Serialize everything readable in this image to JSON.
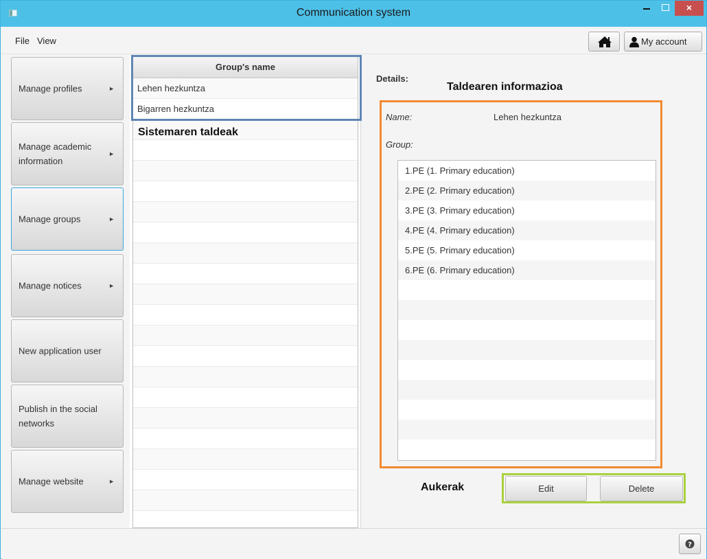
{
  "window": {
    "title": "Communication system",
    "close_label": "×"
  },
  "menubar": {
    "file": "File",
    "view": "View"
  },
  "toolbar": {
    "home_icon": "home-icon",
    "account_icon": "user-icon",
    "account_label": "My account"
  },
  "sidebar": {
    "items": [
      {
        "label": "Manage profiles",
        "arrow": "►"
      },
      {
        "label": "Manage academic information",
        "arrow": "►"
      },
      {
        "label": "Manage groups",
        "arrow": "►",
        "active": true
      },
      {
        "label": "Manage notices",
        "arrow": "►"
      },
      {
        "label": "New application user",
        "arrow": ""
      },
      {
        "label": "Publish in the social networks",
        "arrow": ""
      },
      {
        "label": "Manage website",
        "arrow": "►"
      }
    ]
  },
  "groups_table": {
    "header": "Group's name",
    "rows": [
      "Lehen hezkuntza",
      "Bigarren hezkuntza"
    ],
    "selected_index": 0,
    "caption": "Sistemaren taldeak"
  },
  "details": {
    "label": "Details:",
    "caption": "Taldearen informazioa",
    "name_label": "Name:",
    "name_value": "Lehen hezkuntza",
    "group_label": "Group:",
    "group_items": [
      "1.PE (1. Primary education)",
      "2.PE (2. Primary education)",
      "3.PE (3. Primary education)",
      "4.PE (4. Primary education)",
      "5.PE (5. Primary education)",
      "6.PE (6. Primary education)"
    ]
  },
  "actions": {
    "caption": "Aukerak",
    "edit": "Edit",
    "delete": "Delete"
  },
  "status": {
    "help_icon": "help-icon"
  },
  "colors": {
    "titlebar": "#4dc0e8",
    "highlight_blue": "#5f86b4",
    "highlight_orange": "#f28a2e",
    "highlight_green": "#a9d13d",
    "close_button": "#c7504f"
  }
}
